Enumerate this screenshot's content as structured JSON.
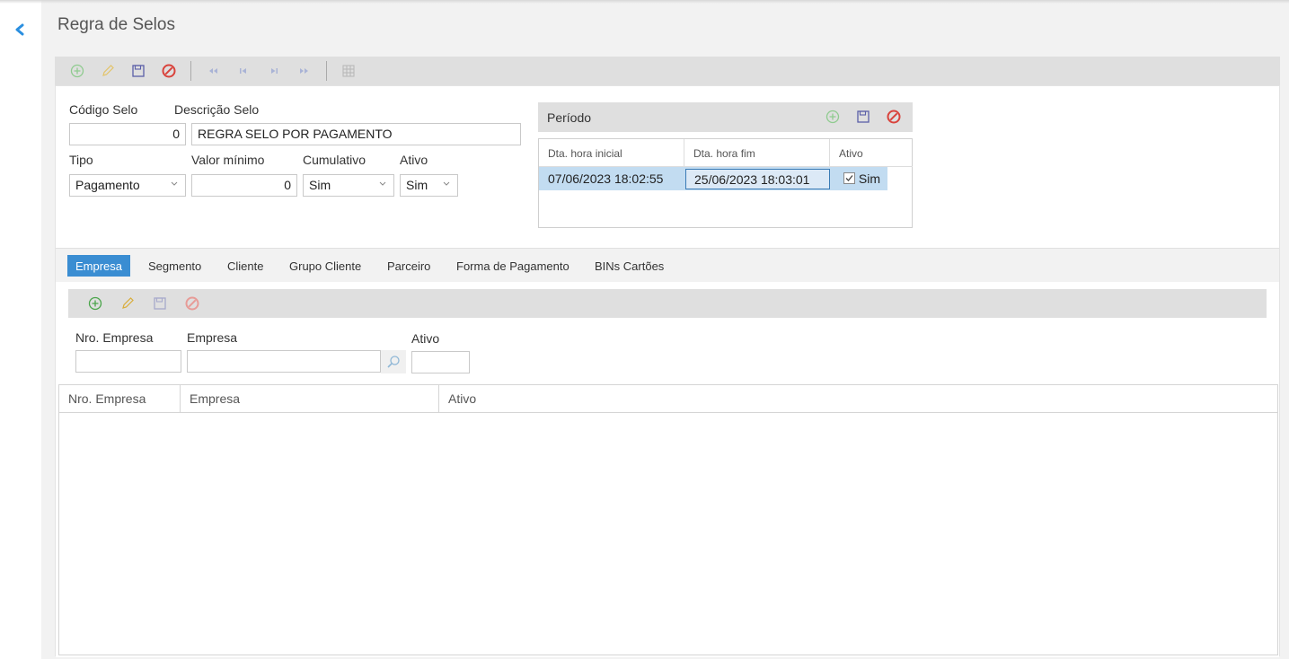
{
  "page": {
    "title": "Regra de Selos"
  },
  "nav": {
    "back_icon": "chevron-left-icon"
  },
  "toolbar": {
    "icons": [
      "add-icon",
      "edit-icon",
      "save-icon",
      "cancel-icon",
      "first-record-icon",
      "previous-record-icon",
      "next-record-icon",
      "last-record-icon",
      "grid-view-icon"
    ]
  },
  "form": {
    "codigo_selo": {
      "label": "Código Selo",
      "value": "0"
    },
    "descricao_selo": {
      "label": "Descrição Selo",
      "value": "REGRA SELO POR PAGAMENTO"
    },
    "tipo": {
      "label": "Tipo",
      "value": "Pagamento"
    },
    "valor_minimo": {
      "label": "Valor mínimo",
      "value": "0"
    },
    "cumulativo": {
      "label": "Cumulativo",
      "value": "Sim"
    },
    "ativo": {
      "label": "Ativo",
      "value": "Sim"
    }
  },
  "periodo": {
    "title": "Período",
    "columns": [
      "Dta. hora inicial",
      "Dta. hora fim",
      "Ativo"
    ],
    "rows": [
      {
        "inicio": "07/06/2023 18:02:55",
        "fim": "25/06/2023 18:03:01",
        "ativo": "Sim",
        "ativo_checked": true
      }
    ]
  },
  "tabs": [
    "Empresa",
    "Segmento",
    "Cliente",
    "Grupo Cliente",
    "Parceiro",
    "Forma de Pagamento",
    "BINs Cartões"
  ],
  "empresa_filter": {
    "nro_empresa": {
      "label": "Nro. Empresa",
      "value": ""
    },
    "empresa": {
      "label": "Empresa",
      "value": ""
    },
    "ativo": {
      "label": "Ativo",
      "value": ""
    }
  },
  "empresa_grid": {
    "columns": [
      "Nro. Empresa",
      "Empresa",
      "Ativo"
    ],
    "rows": []
  },
  "colors": {
    "accent": "#3a8dd2",
    "selected_row": "#c2dcf1",
    "toolbar": "#dfdfdf",
    "add": "#5fb35f",
    "cancel": "#d9433c"
  }
}
